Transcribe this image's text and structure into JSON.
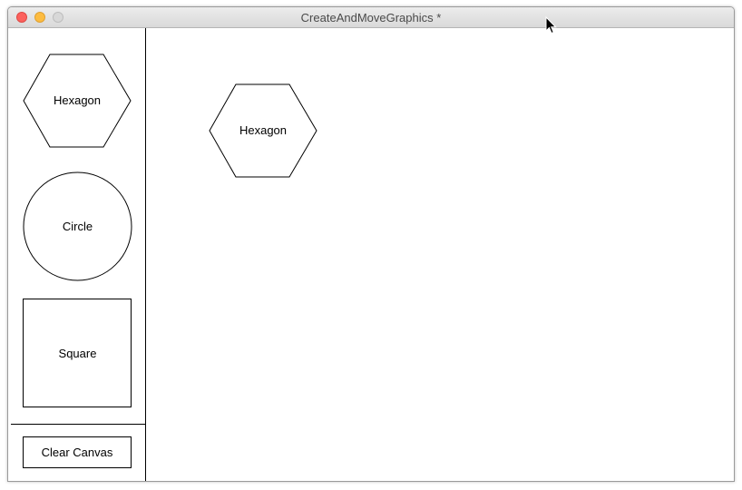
{
  "window": {
    "title": "CreateAndMoveGraphics *"
  },
  "palette": {
    "hexagon_label": "Hexagon",
    "circle_label": "Circle",
    "square_label": "Square",
    "clear_label": "Clear Canvas"
  },
  "canvas": {
    "placed_shapes": [
      {
        "type": "hexagon",
        "label": "Hexagon"
      }
    ]
  },
  "colors": {
    "close": "#fc615d",
    "minimize": "#fdbc40",
    "zoom": "#d8d8d8",
    "stroke": "#000000"
  }
}
